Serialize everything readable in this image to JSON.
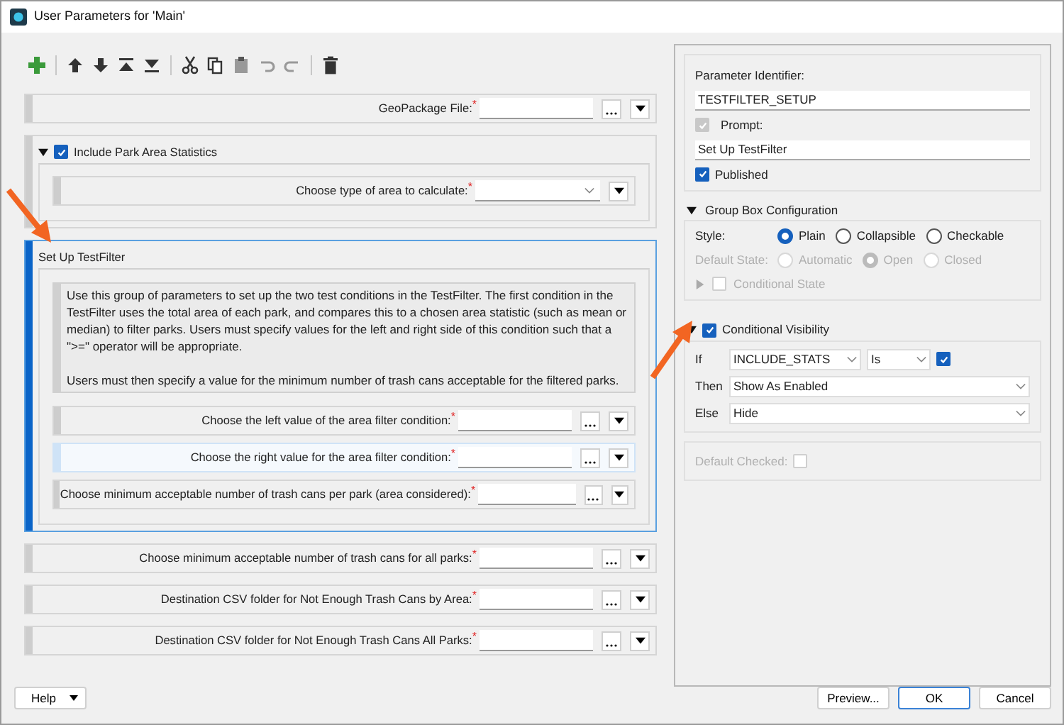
{
  "window": {
    "title": "User Parameters for 'Main'"
  },
  "toolbar": [
    {
      "kind": "add"
    },
    {
      "kind": "sep"
    },
    {
      "kind": "up"
    },
    {
      "kind": "down"
    },
    {
      "kind": "top"
    },
    {
      "kind": "bottom"
    },
    {
      "kind": "sep"
    },
    {
      "kind": "cut"
    },
    {
      "kind": "copy"
    },
    {
      "kind": "paste"
    },
    {
      "kind": "undo"
    },
    {
      "kind": "redo"
    },
    {
      "kind": "sep"
    },
    {
      "kind": "delete"
    }
  ],
  "parameters": [
    {
      "kind": "row",
      "label": "GeoPackage File:",
      "required_mark": "*",
      "selected": false
    },
    {
      "kind": "group",
      "title": "Include Park Area Statistics",
      "checked": true,
      "expanded": true,
      "selected": false,
      "children": [
        {
          "kind": "combo_row",
          "label": "Choose type of area to calculate:",
          "required_mark": "*",
          "selected": false
        }
      ]
    },
    {
      "kind": "group",
      "title": "Set Up TestFilter",
      "selected": true,
      "description": [
        "Use this group of parameters to set up the two test conditions in the TestFilter. The first condition in the TestFilter uses the total area of each park, and compares this to a chosen area statistic (such as mean or median) to filter parks. Users must specify values for the left and right side of this condition such that a \">=\" operator will be appropriate.",
        "Users must then specify a value for the minimum number of trash cans acceptable for the filtered parks."
      ],
      "children": [
        {
          "kind": "row",
          "label": "Choose the left value of the area filter condition:",
          "required_mark": "*",
          "selected": false
        },
        {
          "kind": "row",
          "label": "Choose the right value for the area filter condition:",
          "required_mark": "*",
          "selected": true
        },
        {
          "kind": "row",
          "label": "Choose minimum acceptable number of trash cans per park (area considered):",
          "required_mark": "*",
          "selected": false
        }
      ]
    },
    {
      "kind": "row",
      "label": "Choose minimum acceptable number of trash cans for all parks:",
      "required_mark": "*",
      "selected": false
    },
    {
      "kind": "row",
      "label": "Destination CSV folder for Not Enough Trash Cans by Area:",
      "required_mark": "*",
      "selected": false
    },
    {
      "kind": "row",
      "label": "Destination CSV folder for Not Enough Trash Cans All Parks:",
      "required_mark": "*",
      "selected": false
    }
  ],
  "properties": {
    "identifier_label": "Parameter Identifier:",
    "identifier": "TESTFILTER_SETUP",
    "prompt_label": "Prompt:",
    "prompt_checked": true,
    "prompt": "Set Up TestFilter",
    "published_label": "Published",
    "published": true,
    "group_box": {
      "title": "Group Box Configuration",
      "expanded": true,
      "style_label": "Style:",
      "styles": [
        {
          "label": "Plain",
          "selected": true
        },
        {
          "label": "Collapsible",
          "selected": false
        },
        {
          "label": "Checkable",
          "selected": false
        }
      ],
      "default_state_label": "Default State:",
      "default_state_disabled": true,
      "default_states": [
        {
          "label": "Automatic",
          "selected": false
        },
        {
          "label": "Open",
          "selected": true
        },
        {
          "label": "Closed",
          "selected": false
        }
      ],
      "conditional_state": {
        "label": "Conditional State",
        "checked": false
      }
    },
    "conditional_visibility": {
      "title": "Conditional Visibility",
      "expanded": true,
      "checked": true,
      "if_label": "If",
      "if_value": "INCLUDE_STATS",
      "operator": "Is",
      "value_checked": true,
      "then_label": "Then",
      "then_value": "Show As Enabled",
      "else_label": "Else",
      "else_value": "Hide"
    },
    "default_checked": {
      "label": "Default Checked:",
      "checked": false
    }
  },
  "buttons": {
    "help": "Help",
    "preview": "Preview...",
    "ok": "OK",
    "cancel": "Cancel"
  }
}
